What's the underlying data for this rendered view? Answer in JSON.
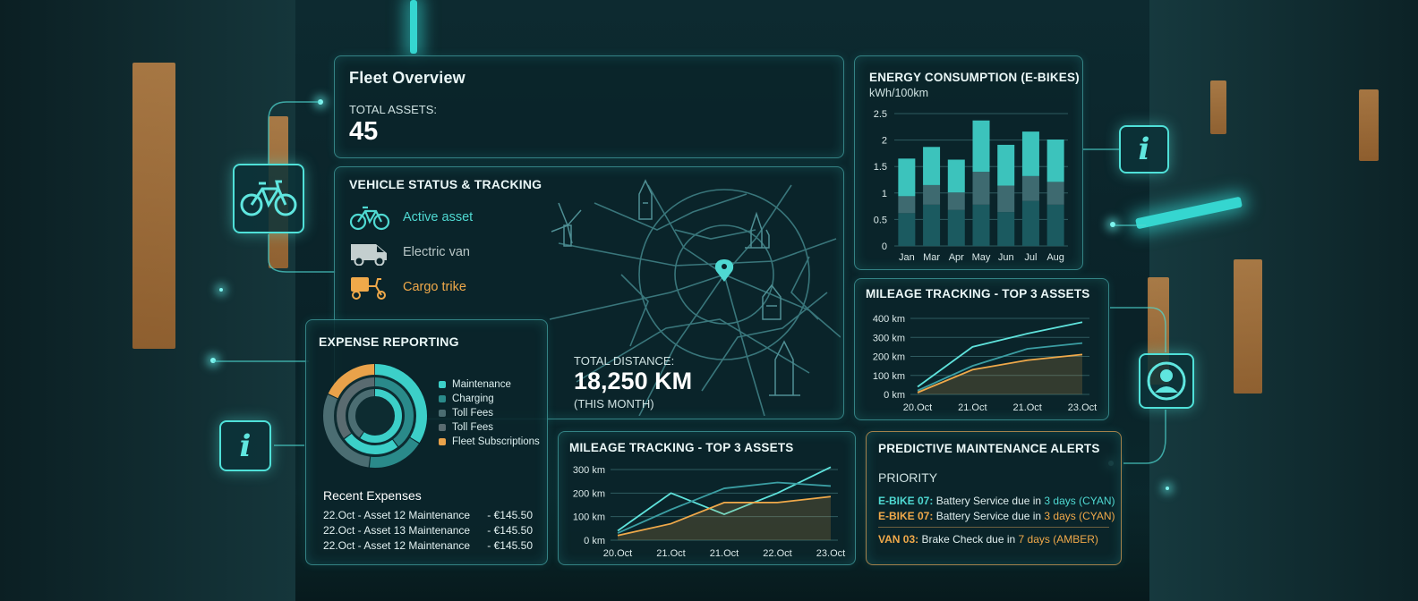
{
  "colors": {
    "accent": "#4fd9d2",
    "amber": "#f0a94a",
    "panel": "#0a242a",
    "bar_dark": "#1b5a60",
    "bar_mid": "#3e6a70"
  },
  "fleet": {
    "title": "Fleet Overview",
    "assets_label": "TOTAL ASSETS:",
    "assets_value": "45"
  },
  "vehicles": {
    "title": "VEHICLE STATUS & TRACKING",
    "items": [
      {
        "label": "Active asset",
        "icon": "bicycle-icon",
        "color": "#4fd9d2"
      },
      {
        "label": "Electric van",
        "icon": "van-icon",
        "color": "#b8c6c6"
      },
      {
        "label": "Cargo trike",
        "icon": "cargo-trike-icon",
        "color": "#f0a94a"
      }
    ],
    "distance_label": "TOTAL DISTANCE:",
    "distance_value": "18,250 KM",
    "distance_period": "(THIS MONTH)"
  },
  "energy": {
    "title": "ENERGY CONSUMPTION (E-BIKES)",
    "subtitle": "kWh/100km"
  },
  "expense": {
    "title": "EXPENSE REPORTING",
    "legend": [
      {
        "label": "Maintenance",
        "color": "#3ccfc8"
      },
      {
        "label": "Charging",
        "color": "#2a8a8a"
      },
      {
        "label": "Toll Fees",
        "color": "#4b6d72"
      },
      {
        "label": "Toll Fees",
        "color": "#5a6b70"
      },
      {
        "label": "Fleet Subscriptions",
        "color": "#e9a24a"
      }
    ],
    "recent_title": "Recent Expenses",
    "rows": [
      {
        "desc": "22.Oct - Asset 12 Maintenance",
        "amount": "- €145.50"
      },
      {
        "desc": "22.Oct - Asset 13 Maintenance",
        "amount": "- €145.50"
      },
      {
        "desc": "22.Oct - Asset 12 Maintenance",
        "amount": "- €145.50"
      }
    ]
  },
  "mileage_right": {
    "title": "MILEAGE TRACKING - TOP 3 ASSETS"
  },
  "mileage_bottom": {
    "title": "MILEAGE TRACKING - TOP 3 ASSETS"
  },
  "alerts": {
    "title": "PREDICTIVE MAINTENANCE ALERTS",
    "priority": "PRIORITY",
    "items": [
      {
        "asset": "E-BIKE 07:",
        "text": " Battery Service due in ",
        "due": "3 days (CYAN)",
        "level": "cyan"
      },
      {
        "asset": "E-BIKE 07:",
        "text": " Battery Service due in ",
        "due": "3 days (CYAN)",
        "level": "amber"
      },
      {
        "asset": "VAN 03:",
        "text": " Brake Check due in ",
        "due": "7 days (AMBER)",
        "level": "amber"
      }
    ]
  },
  "chart_data": [
    {
      "id": "energy",
      "type": "bar",
      "stacked": true,
      "categories": [
        "Jan",
        "Mar",
        "Apr",
        "May",
        "Jun",
        "Jul",
        "Aug"
      ],
      "series": [
        {
          "values": [
            0.62,
            0.78,
            0.68,
            0.78,
            0.64,
            0.85,
            0.78
          ],
          "color": "#1b5a60"
        },
        {
          "values": [
            0.32,
            0.37,
            0.33,
            0.62,
            0.5,
            0.47,
            0.43
          ],
          "color": "#3e6a70"
        },
        {
          "values": [
            0.71,
            0.72,
            0.62,
            0.97,
            0.77,
            0.84,
            0.8
          ],
          "color": "#3cc3bc"
        }
      ],
      "yticks": [
        0,
        0.5,
        1,
        1.5,
        2,
        2.5
      ],
      "ylim": [
        0,
        2.5
      ]
    },
    {
      "id": "mileage_right",
      "type": "line",
      "x": [
        "20.Oct",
        "21.Oct",
        "21.Oct",
        "23.Oct"
      ],
      "yticks": [
        "0 km",
        "100 km",
        "200 km",
        "300 km",
        "400 km"
      ],
      "ylim": [
        0,
        400
      ],
      "series": [
        {
          "values": [
            40,
            250,
            320,
            380
          ],
          "color": "#5fe3dc"
        },
        {
          "values": [
            20,
            150,
            240,
            270
          ],
          "color": "#3b9ea3"
        },
        {
          "values": [
            10,
            130,
            180,
            210
          ],
          "color": "#f0a94a"
        }
      ]
    },
    {
      "id": "mileage_bottom",
      "type": "line",
      "x": [
        "20.Oct",
        "21.Oct",
        "21.Oct",
        "22.Oct",
        "23.Oct"
      ],
      "yticks": [
        "0 km",
        "100 km",
        "200 km",
        "300 km"
      ],
      "ylim": [
        0,
        300
      ],
      "series": [
        {
          "values": [
            40,
            200,
            110,
            200,
            310
          ],
          "color": "#5fe3dc"
        },
        {
          "values": [
            30,
            130,
            220,
            245,
            230
          ],
          "color": "#3b9ea3"
        },
        {
          "values": [
            20,
            70,
            160,
            160,
            185
          ],
          "color": "#f0a94a"
        }
      ]
    },
    {
      "id": "expense_donut",
      "type": "pie",
      "rings": [
        {
          "values": [
            34,
            18,
            30,
            18
          ],
          "colors": [
            "#3ccfc8",
            "#2a8a8a",
            "#4b6d72",
            "#e9a24a"
          ]
        },
        {
          "values": [
            40,
            25,
            35
          ],
          "colors": [
            "#2a8a8a",
            "#3ccfc8",
            "#5a6b70"
          ]
        },
        {
          "values": [
            60,
            40
          ],
          "colors": [
            "#3ccfc8",
            "#4b6d72"
          ]
        }
      ]
    }
  ]
}
